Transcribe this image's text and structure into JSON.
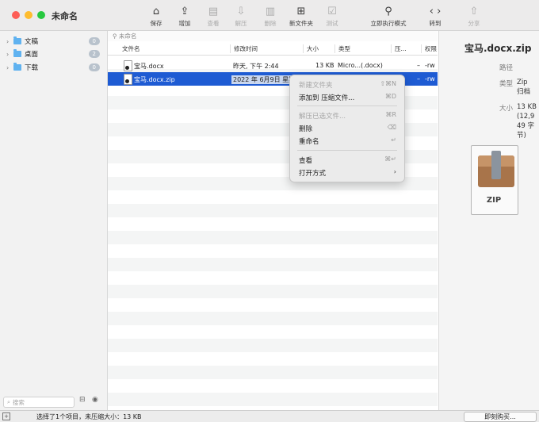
{
  "window": {
    "title": "未命名"
  },
  "toolbar": [
    {
      "label": "保存",
      "icon": "save-icon",
      "glyph": "⌂",
      "enabled": true,
      "has_menu": true
    },
    {
      "label": "增加",
      "icon": "add-icon",
      "glyph": "⇪",
      "enabled": true,
      "has_menu": false
    },
    {
      "label": "查看",
      "icon": "view-icon",
      "glyph": "▤",
      "enabled": false,
      "has_menu": true
    },
    {
      "label": "解压",
      "icon": "extract-icon",
      "glyph": "⇩",
      "enabled": false,
      "has_menu": true
    },
    {
      "label": "删除",
      "icon": "trash-icon",
      "glyph": "▥",
      "enabled": false,
      "has_menu": true
    },
    {
      "label": "新文件夹",
      "icon": "new-folder-icon",
      "glyph": "⊞",
      "enabled": true,
      "has_menu": false
    },
    {
      "label": "测试",
      "icon": "test-icon",
      "glyph": "☑",
      "enabled": false,
      "has_menu": false
    },
    {
      "label": "立即执行模式",
      "icon": "execute-mode-icon",
      "glyph": "⚲",
      "enabled": true,
      "has_menu": false
    },
    {
      "label": "转到",
      "icon": "goto-icon",
      "glyph": "‹ ›",
      "enabled": true,
      "has_menu": false
    },
    {
      "label": "分享",
      "icon": "share-icon",
      "glyph": "⇧",
      "enabled": false,
      "has_menu": false
    }
  ],
  "sidebar": {
    "items": [
      {
        "label": "文稿",
        "count": "0"
      },
      {
        "label": "桌面",
        "count": "2"
      },
      {
        "label": "下载",
        "count": "0"
      }
    ],
    "search_placeholder": "搜索"
  },
  "pathbar": {
    "label": "未命名"
  },
  "columns": [
    "文件名",
    "修改时间",
    "大小",
    "类型",
    "压...",
    "权限"
  ],
  "files": [
    {
      "name": "宝马.docx",
      "modified": "昨天, 下午 2:44",
      "size": "13 KB",
      "type": "Micro...(.docx)",
      "compress": "–",
      "perm": "-rw",
      "selected": false
    },
    {
      "name": "宝马.docx.zip",
      "modified": "2022 年 6月9日 星期四 下午 8:55",
      "size": "",
      "type": "",
      "compress": "–",
      "perm": "-rw",
      "selected": true
    }
  ],
  "context_menu": {
    "items": [
      {
        "label": "新建文件夹",
        "shortcut": "⇧⌘N",
        "enabled": false
      },
      {
        "label": "添加到 压缩文件...",
        "shortcut": "⌘D",
        "enabled": true
      },
      {
        "label": "解压已选文件...",
        "shortcut": "⌘R",
        "enabled": false
      },
      {
        "label": "删除",
        "shortcut": "⌫",
        "enabled": true
      },
      {
        "label": "重命名",
        "shortcut": "↵",
        "enabled": true
      },
      {
        "label": "查看",
        "shortcut": "⌘↵",
        "enabled": true
      },
      {
        "label": "打开方式",
        "shortcut": "›",
        "enabled": true
      }
    ]
  },
  "inspector": {
    "title": "宝马.docx.zip",
    "path_key": "路径",
    "type_key": "类型",
    "type_value": [
      "Zip",
      "归档"
    ],
    "size_key": "大小",
    "size_value": [
      "13 KB",
      "(12,9",
      "49 字",
      "节)"
    ],
    "icon_label": "ZIP"
  },
  "statusbar": {
    "text": "选择了1个项目，未压缩大小：13 KB",
    "buy_label": "即刻购买..."
  }
}
